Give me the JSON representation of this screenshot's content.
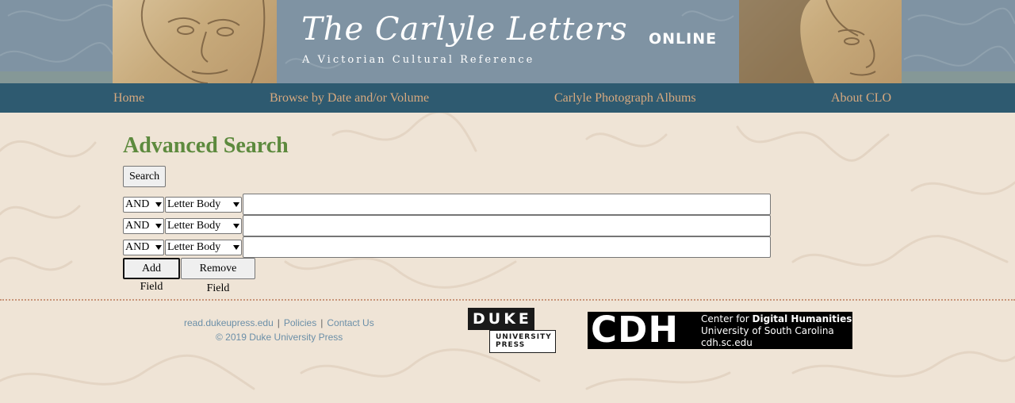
{
  "header": {
    "title": "The Carlyle Letters",
    "title_suffix": "ONLINE",
    "subtitle": "A Victorian Cultural Reference"
  },
  "nav": {
    "items": [
      {
        "label": "Home"
      },
      {
        "label": "Browse by Date and/or Volume"
      },
      {
        "label": "Carlyle Photograph Albums"
      },
      {
        "label": "About CLO"
      }
    ]
  },
  "main": {
    "title": "Advanced Search",
    "search_button": "Search",
    "rows": [
      {
        "operator": "AND",
        "field": "Letter Body",
        "value": ""
      },
      {
        "operator": "AND",
        "field": "Letter Body",
        "value": ""
      },
      {
        "operator": "AND",
        "field": "Letter Body",
        "value": ""
      }
    ],
    "add_field_button": "Add Field",
    "remove_field_button": "Remove Field"
  },
  "footer": {
    "links": [
      {
        "label": "read.dukeupress.edu"
      },
      {
        "label": "Policies"
      },
      {
        "label": "Contact Us"
      }
    ],
    "separator": "|",
    "copyright": "© 2019 Duke University Press",
    "duke_logo": {
      "top": "DUKE",
      "line1": "UNIVERSITY",
      "line2": "PRESS"
    },
    "cdh_logo": {
      "abbr": "CDH",
      "line1_prefix": "Center for ",
      "line1_bold": "Digital Humanities",
      "line2": "University of South Carolina",
      "line3": "cdh.sc.edu"
    }
  },
  "colors": {
    "banner": "#7f93a3",
    "nav": "#2e5a70",
    "nav_link": "#d7a97f",
    "title": "#5d8a3e",
    "footer_link": "#6b8fa8",
    "background": "#efe4d6"
  }
}
